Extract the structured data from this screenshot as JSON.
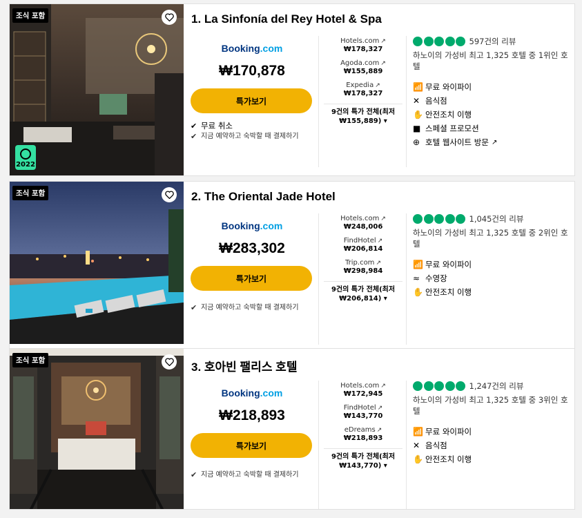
{
  "hotels": [
    {
      "title": "1. La Sinfonía del Rey Hotel & Spa",
      "badge": "조식 포함",
      "award": "2022",
      "provider_logo": {
        "left": "Booking",
        "right": ".com"
      },
      "price": "₩170,878",
      "deal_button": "특가보기",
      "perks": [
        "무료 취소",
        "지금 예약하고 숙박할 때 결제하기"
      ],
      "providers": [
        {
          "name": "Hotels.com",
          "price": "₩178,327"
        },
        {
          "name": "Agoda.com",
          "price": "₩155,889"
        },
        {
          "name": "Expedia",
          "price": "₩178,327"
        }
      ],
      "all_deals": {
        "line1": "9건의 특가 전체(최저",
        "line2": "₩155,889)"
      },
      "rating_bubbles": 5,
      "reviews": "597건의 리뷰",
      "ranking": "하노이의 가성비 최고 1,325 호텔 중 1위인 호텔",
      "amenities": [
        {
          "icon": "wifi-icon",
          "label": "무료 와이파이"
        },
        {
          "icon": "restaurant-icon",
          "label": "음식점"
        },
        {
          "icon": "safety-icon",
          "label": "안전조치 이행"
        },
        {
          "icon": "tag-icon",
          "label": "스페셜 프로모션"
        },
        {
          "icon": "globe-icon",
          "label": "호텔 웹사이트 방문"
        }
      ]
    },
    {
      "title": "2. The Oriental Jade Hotel",
      "badge": "조식 포함",
      "provider_logo": {
        "left": "Booking",
        "right": ".com"
      },
      "price": "₩283,302",
      "deal_button": "특가보기",
      "perks": [
        "지금 예약하고 숙박할 때 결제하기"
      ],
      "providers": [
        {
          "name": "Hotels.com",
          "price": "₩248,006"
        },
        {
          "name": "FindHotel",
          "price": "₩206,814"
        },
        {
          "name": "Trip.com",
          "price": "₩298,984"
        }
      ],
      "all_deals": {
        "line1": "9건의 특가 전체(최저",
        "line2": "₩206,814)"
      },
      "rating_bubbles": 5,
      "reviews": "1,045건의 리뷰",
      "ranking": "하노이의 가성비 최고 1,325 호텔 중 2위인 호텔",
      "amenities": [
        {
          "icon": "wifi-icon",
          "label": "무료 와이파이"
        },
        {
          "icon": "pool-icon",
          "label": "수영장"
        },
        {
          "icon": "safety-icon",
          "label": "안전조치 이행"
        }
      ]
    },
    {
      "title": "3. 호아빈 팰리스 호텔",
      "badge": "조식 포함",
      "provider_logo": {
        "left": "Booking",
        "right": ".com"
      },
      "price": "₩218,893",
      "deal_button": "특가보기",
      "perks": [
        "지금 예약하고 숙박할 때 결제하기"
      ],
      "providers": [
        {
          "name": "Hotels.com",
          "price": "₩172,945"
        },
        {
          "name": "FindHotel",
          "price": "₩143,770"
        },
        {
          "name": "eDreams",
          "price": "₩218,893"
        }
      ],
      "all_deals": {
        "line1": "9건의 특가 전체(최저",
        "line2": "₩143,770)"
      },
      "rating_bubbles": 5,
      "reviews": "1,247건의 리뷰",
      "ranking": "하노이의 가성비 최고 1,325 호텔 중 3위인 호텔",
      "amenities": [
        {
          "icon": "wifi-icon",
          "label": "무료 와이파이"
        },
        {
          "icon": "restaurant-icon",
          "label": "음식점"
        },
        {
          "icon": "safety-icon",
          "label": "안전조치 이행"
        }
      ]
    }
  ],
  "colors": {
    "deal_button": "#f2b203",
    "bubble": "#00aa6c",
    "booking_blue": "#003580",
    "booking_dot": "#009fe3",
    "award": "#34e0a1"
  }
}
